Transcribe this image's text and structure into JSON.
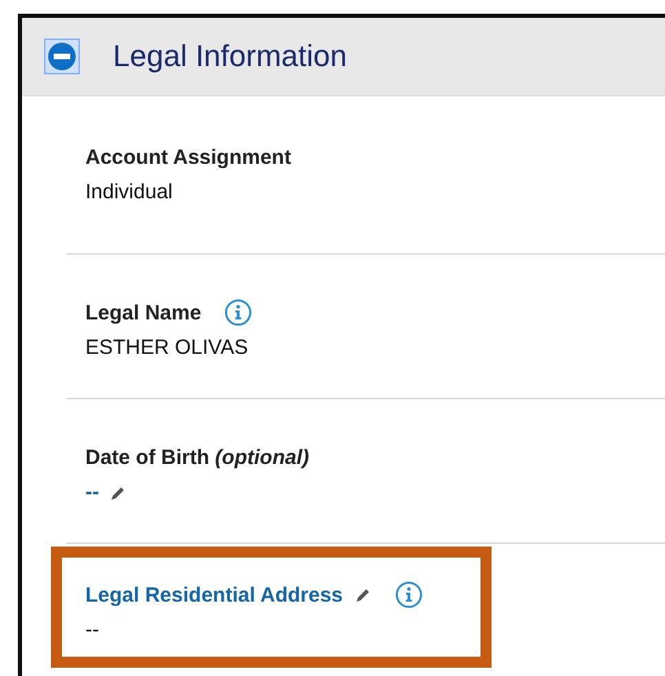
{
  "section": {
    "title": "Legal Information",
    "expanded": true
  },
  "fields": [
    {
      "label": "Account Assignment",
      "value": "Individual",
      "label_link": false,
      "value_link": false,
      "info": false,
      "editable": false,
      "highlighted": false
    },
    {
      "label": "Legal Name",
      "value": "ESTHER OLIVAS",
      "label_link": false,
      "value_link": false,
      "info": true,
      "editable": false,
      "highlighted": false
    },
    {
      "label": "Date of Birth",
      "note": "(optional)",
      "value": "--",
      "label_link": false,
      "value_link": true,
      "info": false,
      "editable": true,
      "highlighted": false
    },
    {
      "label": "Legal Residential Address",
      "value": "--",
      "label_link": true,
      "value_link": false,
      "info": true,
      "editable": true,
      "highlighted": true
    }
  ]
}
